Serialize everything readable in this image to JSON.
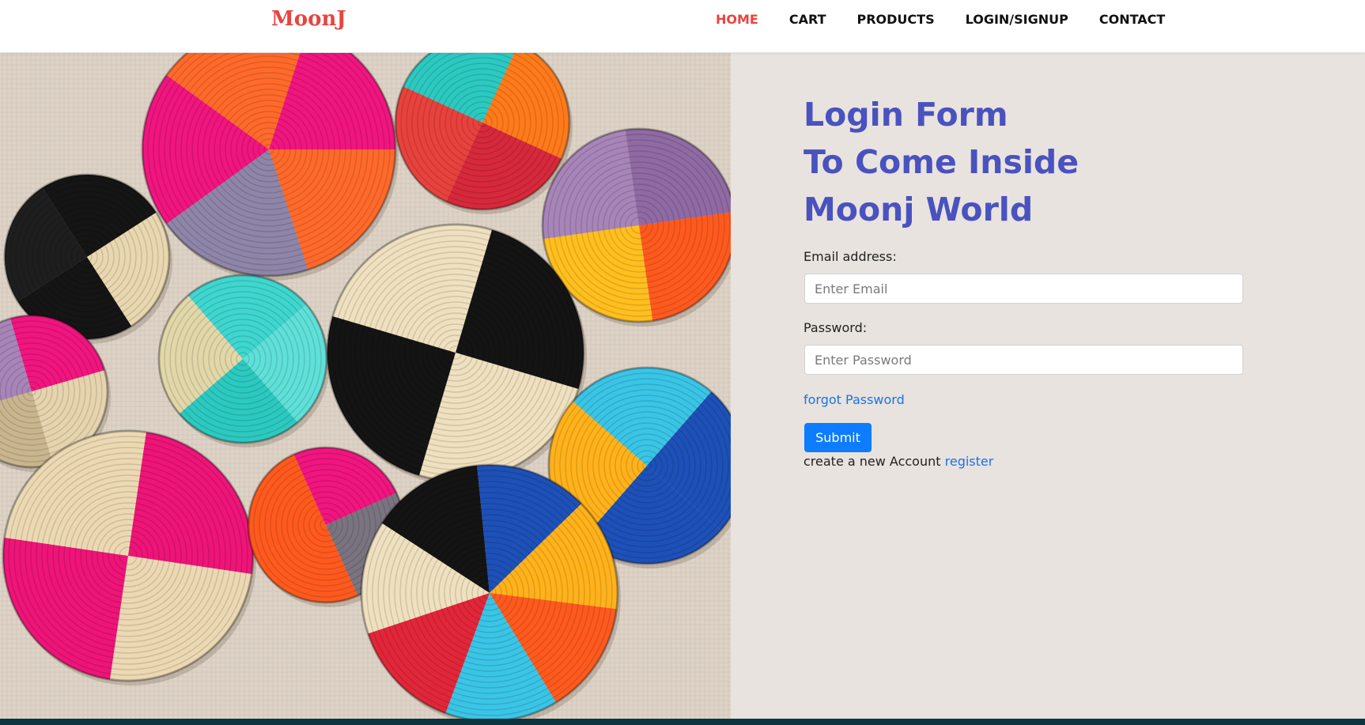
{
  "header": {
    "logo": "MoonJ",
    "nav": [
      {
        "label": "HOME",
        "active": true
      },
      {
        "label": "CART"
      },
      {
        "label": "PRODUCTS"
      },
      {
        "label": "LOGIN/SIGNUP"
      },
      {
        "label": "CONTACT"
      }
    ],
    "accent_color": "#e8443f"
  },
  "form": {
    "title_lines": [
      "Login Form",
      "To Come Inside",
      "Moonj World"
    ],
    "email_label": "Email address:",
    "email_placeholder": "Enter Email",
    "email_value": "",
    "password_label": "Password:",
    "password_placeholder": "Enter Password",
    "password_value": "",
    "forgot_link": "forgot Password",
    "submit_label": "Submit",
    "create_text": "create a new Account",
    "register_link": "register",
    "title_color": "#4a52bf",
    "button_color": "#0d7cff",
    "link_color": "#1a73e8"
  },
  "hero_image": {
    "icon": "woven-baskets-image"
  }
}
